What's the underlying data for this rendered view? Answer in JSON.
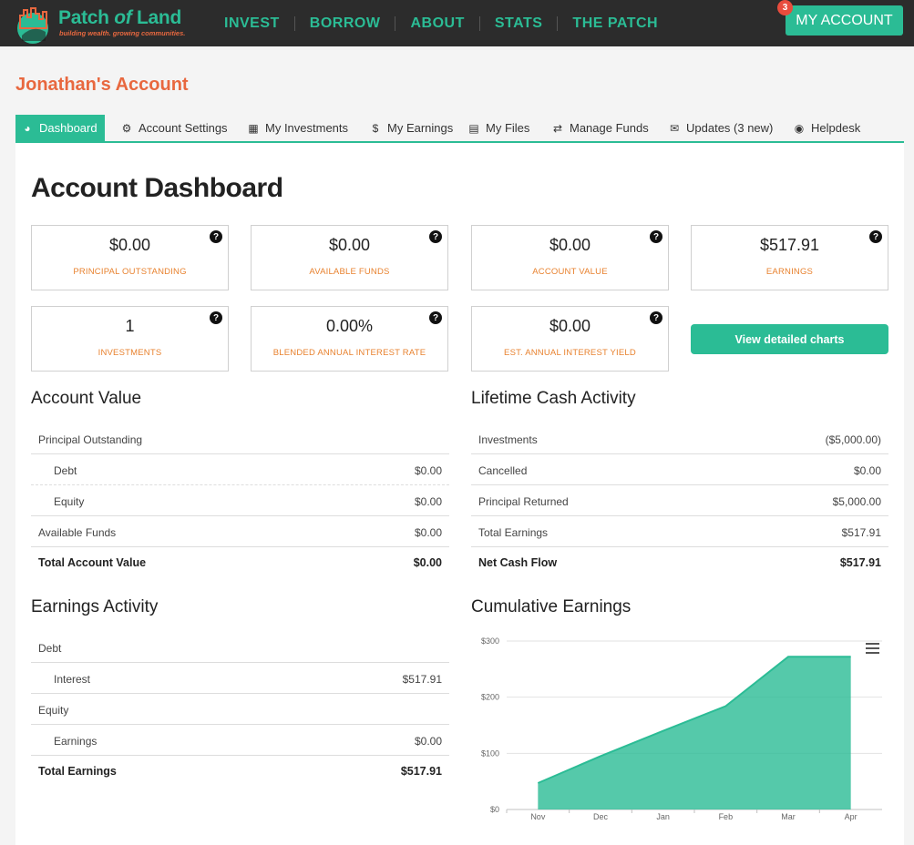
{
  "brand": {
    "name_plain": "Patch ",
    "name_italic": "of",
    "name_end": " Land",
    "tagline": "building wealth. growing communities."
  },
  "nav": [
    "INVEST",
    "BORROW",
    "ABOUT",
    "STATS",
    "THE PATCH"
  ],
  "account_button": {
    "label": "MY ACCOUNT",
    "badge": "3"
  },
  "account_title": "Jonathan's Account",
  "tabs": [
    {
      "label": "Dashboard",
      "icon": "dashboard-icon"
    },
    {
      "label": "Account Settings",
      "icon": "gear-icon"
    },
    {
      "label": "My Investments",
      "icon": "building-icon"
    },
    {
      "label": "My Earnings",
      "icon": "dollar-icon"
    },
    {
      "label": "My Files",
      "icon": "file-icon"
    },
    {
      "label": "Manage Funds",
      "icon": "exchange-icon"
    },
    {
      "label": "Updates (3 new)",
      "icon": "envelope-icon"
    },
    {
      "label": "Helpdesk",
      "icon": "comments-icon"
    }
  ],
  "dashboard_title": "Account Dashboard",
  "cards": [
    {
      "value": "$0.00",
      "label": "PRINCIPAL OUTSTANDING"
    },
    {
      "value": "$0.00",
      "label": "AVAILABLE FUNDS"
    },
    {
      "value": "$0.00",
      "label": "ACCOUNT VALUE"
    },
    {
      "value": "$517.91",
      "label": "EARNINGS"
    },
    {
      "value": "1",
      "label": "INVESTMENTS"
    },
    {
      "value": "0.00%",
      "label": "BLENDED ANNUAL INTEREST RATE"
    },
    {
      "value": "$0.00",
      "label": "EST. ANNUAL INTEREST YIELD"
    }
  ],
  "help_glyph": "?",
  "charts_button": "View detailed charts",
  "account_value": {
    "title": "Account Value",
    "rows": [
      {
        "label": "Principal Outstanding",
        "value": ""
      },
      {
        "label": "Debt",
        "value": "$0.00"
      },
      {
        "label": "Equity",
        "value": "$0.00"
      },
      {
        "label": "Available Funds",
        "value": "$0.00"
      },
      {
        "label": "Total Account Value",
        "value": "$0.00"
      }
    ]
  },
  "lifetime": {
    "title": "Lifetime Cash Activity",
    "rows": [
      {
        "label": "Investments",
        "value": "($5,000.00)"
      },
      {
        "label": "Cancelled",
        "value": "$0.00"
      },
      {
        "label": "Principal Returned",
        "value": "$5,000.00"
      },
      {
        "label": "Total Earnings",
        "value": "$517.91"
      },
      {
        "label": "Net Cash Flow",
        "value": "$517.91"
      }
    ]
  },
  "earnings_activity": {
    "title": "Earnings Activity",
    "rows": [
      {
        "label": "Debt",
        "value": ""
      },
      {
        "label": "Interest",
        "value": "$517.91"
      },
      {
        "label": "Equity",
        "value": ""
      },
      {
        "label": "Earnings",
        "value": "$0.00"
      },
      {
        "label": "Total Earnings",
        "value": "$517.91"
      }
    ]
  },
  "cumulative_title": "Cumulative Earnings",
  "chart_data": {
    "type": "area",
    "x": [
      "Nov",
      "Dec",
      "Jan",
      "Feb",
      "Mar",
      "Apr"
    ],
    "values": [
      47,
      95,
      140,
      184,
      272,
      272
    ],
    "ylim": [
      0,
      300
    ],
    "yticks": [
      "$0",
      "$100",
      "$200",
      "$300"
    ],
    "color": "#2bbc95"
  },
  "colors": {
    "accent": "#2bbc95",
    "orange": "#e8683f",
    "topbar": "#2c2c2c"
  }
}
